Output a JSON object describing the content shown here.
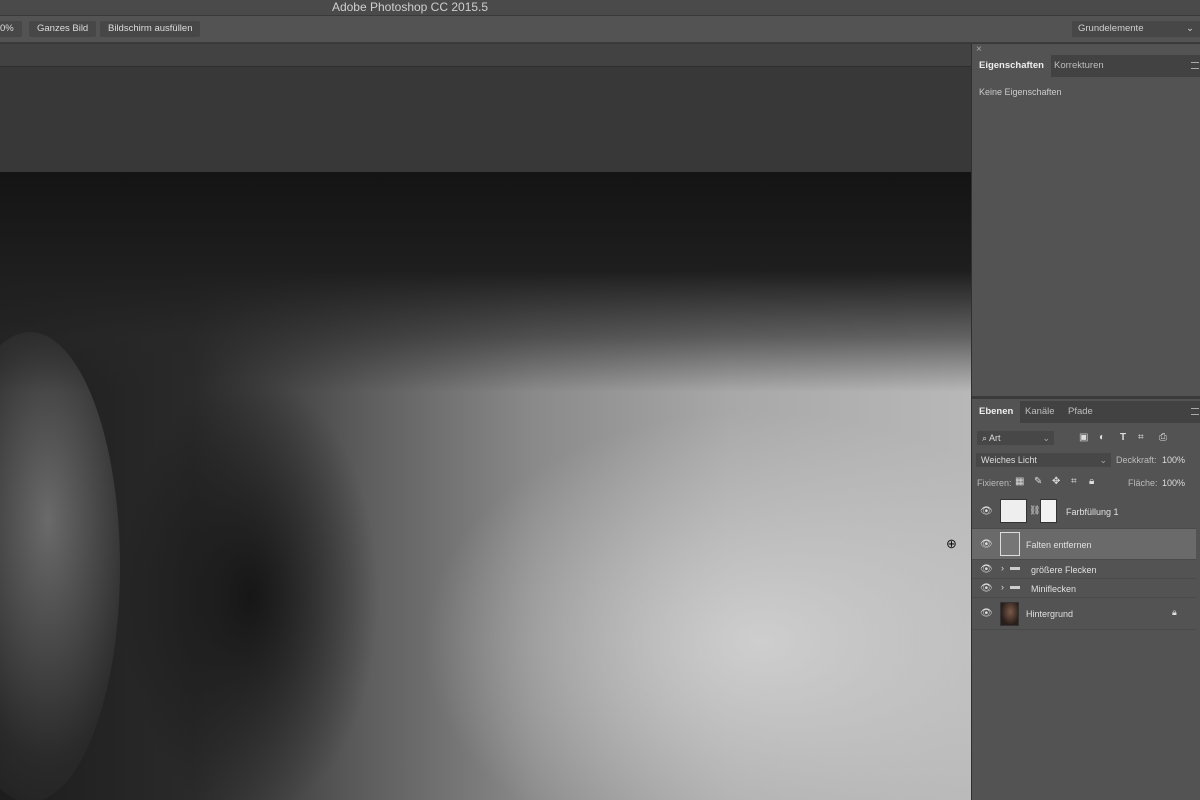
{
  "app": {
    "title": "Adobe Photoshop CC 2015.5"
  },
  "options_bar": {
    "zoom_value": "0%",
    "fit_screen": "Ganzes Bild",
    "fill_screen": "Bildschirm ausfüllen",
    "workspace": "Grundelemente"
  },
  "properties_panel": {
    "close": "×",
    "tabs": [
      {
        "label": "Eigenschaften",
        "active": true
      },
      {
        "label": "Korrekturen"
      }
    ],
    "message": "Keine Eigenschaften"
  },
  "layers_panel": {
    "tabs": [
      {
        "label": "Ebenen",
        "active": true
      },
      {
        "label": "Kanäle"
      },
      {
        "label": "Pfade"
      }
    ],
    "filter": "Art",
    "blend_mode": "Weiches Licht",
    "opacity_label": "Deckkraft:",
    "opacity": "100%",
    "lock_label": "Fixieren:",
    "fill_label": "Fläche:",
    "fill": "100%",
    "layers": [
      {
        "name": "Farbfüllung 1",
        "type": "fill",
        "visible": true
      },
      {
        "name": "Falten entfernen",
        "type": "pixel",
        "visible": true,
        "selected": true
      },
      {
        "name": "größere Flecken",
        "type": "group",
        "visible": true
      },
      {
        "name": "Miniflecken",
        "type": "group",
        "visible": true
      },
      {
        "name": "Hintergrund",
        "type": "background",
        "visible": true,
        "locked": true
      }
    ]
  }
}
